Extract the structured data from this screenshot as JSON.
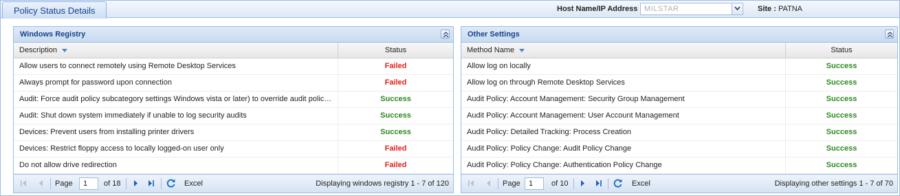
{
  "header": {
    "tab_title": "Policy Status Details",
    "host_label": "Host Name/IP Address",
    "host_value": "MILSTAR",
    "site_label": "Site :",
    "site_value": "PATNA"
  },
  "colors": {
    "failed": "#e0201b",
    "success": "#2b8a20",
    "accent": "#15428b"
  },
  "left_panel": {
    "title": "Windows Registry",
    "col_description": "Description",
    "col_status": "Status",
    "rows": [
      {
        "description": "Allow users to connect remotely using Remote Desktop Services",
        "status": "Failed"
      },
      {
        "description": "Always prompt for password upon connection",
        "status": "Failed"
      },
      {
        "description": "Audit: Force audit policy subcategory settings Windows vista or later) to override audit polic…",
        "status": "Success"
      },
      {
        "description": "Audit: Shut down system immediately if unable to log security audits",
        "status": "Success"
      },
      {
        "description": "Devices: Prevent users from installing printer drivers",
        "status": "Success"
      },
      {
        "description": "Devices: Restrict floppy access to locally logged-on user only",
        "status": "Failed"
      },
      {
        "description": "Do not allow drive redirection",
        "status": "Failed"
      }
    ],
    "pager": {
      "page_label": "Page",
      "page_value": "1",
      "of_label": "of 18",
      "excel_label": "Excel",
      "display_text": "Displaying windows registry 1 - 7 of 120"
    }
  },
  "right_panel": {
    "title": "Other Settings",
    "col_method": "Method Name",
    "col_status": "Status",
    "rows": [
      {
        "description": "Allow log on locally",
        "status": "Success"
      },
      {
        "description": "Allow log on through Remote Desktop Services",
        "status": "Success"
      },
      {
        "description": "Audit Policy: Account Management: Security Group Management",
        "status": "Success"
      },
      {
        "description": "Audit Policy: Account Management: User Account Management",
        "status": "Success"
      },
      {
        "description": "Audit Policy: Detailed Tracking: Process Creation",
        "status": "Success"
      },
      {
        "description": "Audit Policy: Policy Change: Audit Policy Change",
        "status": "Success"
      },
      {
        "description": "Audit Policy: Policy Change: Authentication Policy Change",
        "status": "Success"
      }
    ],
    "pager": {
      "page_label": "Page",
      "page_value": "1",
      "of_label": "of 10",
      "excel_label": "Excel",
      "display_text": "Displaying other settings 1 - 7 of 70"
    }
  }
}
